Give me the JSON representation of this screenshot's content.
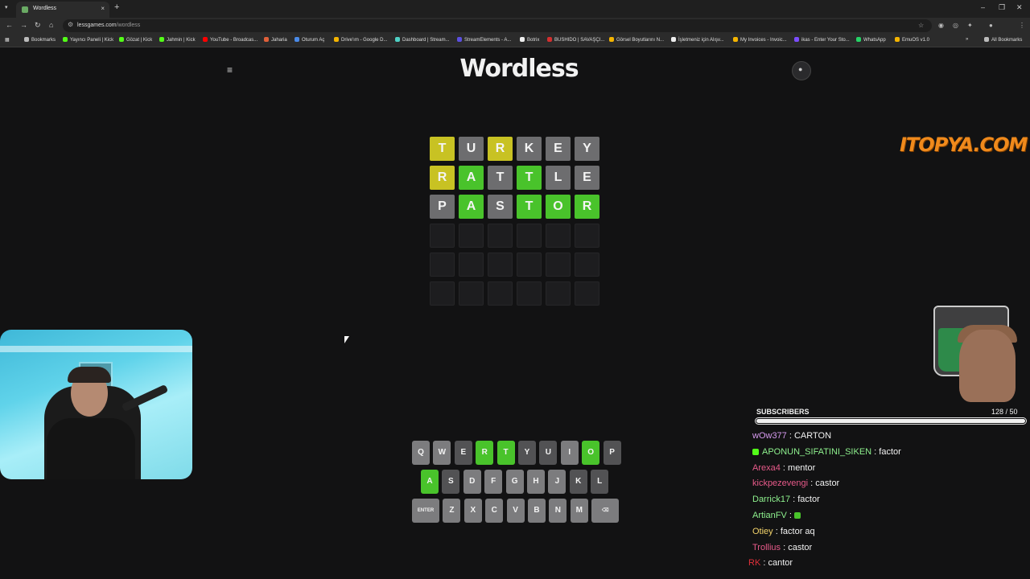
{
  "browser": {
    "tab_title": "Wordless",
    "url_host": "lessgames.com",
    "url_path": "/wordless",
    "bookmarks": [
      "Bookmarks",
      "Yayıncı Paneli | Kick",
      "Gözat | Kick",
      "Jahmin | Kick",
      "YouTube - Broadcas...",
      "Jaharia",
      "Oturum Aç",
      "Drive'ım - Google D...",
      "Dashboard | Stream...",
      "StreamElements - A...",
      "Botrix",
      "BUSHIDO | SAVAŞÇI...",
      "Görsel Boyutlarını N...",
      "İşletmeniz için Alışv...",
      "My Invoices - Invoic...",
      "ikas - Enter Your Sto...",
      "WhatsApp",
      "EmuOS v1.0"
    ],
    "all_bookmarks": "All Bookmarks",
    "icons": {
      "back": "←",
      "forward": "→",
      "reload": "↻",
      "home": "⌂",
      "star": "☆",
      "close": "×",
      "new_tab": "+",
      "menu": "⋮",
      "minimize": "–",
      "restore": "❐",
      "window_close": "✕",
      "apps": "▦",
      "tab_list": "▾",
      "tune": "⚙",
      "chevrons": "»"
    }
  },
  "app": {
    "title": "Wordless",
    "menu_icon": "≡",
    "profile_icon": "person-icon"
  },
  "board": [
    [
      {
        "l": "T",
        "s": "present"
      },
      {
        "l": "U",
        "s": "absent"
      },
      {
        "l": "R",
        "s": "present"
      },
      {
        "l": "K",
        "s": "absent"
      },
      {
        "l": "E",
        "s": "absent"
      },
      {
        "l": "Y",
        "s": "absent"
      }
    ],
    [
      {
        "l": "R",
        "s": "present"
      },
      {
        "l": "A",
        "s": "correct"
      },
      {
        "l": "T",
        "s": "absent"
      },
      {
        "l": "T",
        "s": "correct"
      },
      {
        "l": "L",
        "s": "absent"
      },
      {
        "l": "E",
        "s": "absent"
      }
    ],
    [
      {
        "l": "P",
        "s": "absent"
      },
      {
        "l": "A",
        "s": "correct"
      },
      {
        "l": "S",
        "s": "absent"
      },
      {
        "l": "T",
        "s": "correct"
      },
      {
        "l": "O",
        "s": "correct"
      },
      {
        "l": "R",
        "s": "correct"
      }
    ],
    [
      {
        "l": "",
        "s": "empty"
      },
      {
        "l": "",
        "s": "empty"
      },
      {
        "l": "",
        "s": "empty"
      },
      {
        "l": "",
        "s": "empty"
      },
      {
        "l": "",
        "s": "empty"
      },
      {
        "l": "",
        "s": "empty"
      }
    ],
    [
      {
        "l": "",
        "s": "empty"
      },
      {
        "l": "",
        "s": "empty"
      },
      {
        "l": "",
        "s": "empty"
      },
      {
        "l": "",
        "s": "empty"
      },
      {
        "l": "",
        "s": "empty"
      },
      {
        "l": "",
        "s": "empty"
      }
    ],
    [
      {
        "l": "",
        "s": "empty"
      },
      {
        "l": "",
        "s": "empty"
      },
      {
        "l": "",
        "s": "empty"
      },
      {
        "l": "",
        "s": "empty"
      },
      {
        "l": "",
        "s": "empty"
      },
      {
        "l": "",
        "s": "empty"
      }
    ]
  ],
  "keyboard": [
    [
      {
        "k": "Q",
        "s": ""
      },
      {
        "k": "W",
        "s": ""
      },
      {
        "k": "E",
        "s": "absent"
      },
      {
        "k": "R",
        "s": "correct"
      },
      {
        "k": "T",
        "s": "correct"
      },
      {
        "k": "Y",
        "s": "absent"
      },
      {
        "k": "U",
        "s": "absent"
      },
      {
        "k": "I",
        "s": ""
      },
      {
        "k": "O",
        "s": "correct"
      },
      {
        "k": "P",
        "s": "absent"
      }
    ],
    [
      {
        "k": "A",
        "s": "correct"
      },
      {
        "k": "S",
        "s": "absent"
      },
      {
        "k": "D",
        "s": ""
      },
      {
        "k": "F",
        "s": ""
      },
      {
        "k": "G",
        "s": ""
      },
      {
        "k": "H",
        "s": ""
      },
      {
        "k": "J",
        "s": ""
      },
      {
        "k": "K",
        "s": "absent"
      },
      {
        "k": "L",
        "s": "absent"
      }
    ],
    [
      {
        "k": "ENTER",
        "s": "wide"
      },
      {
        "k": "Z",
        "s": ""
      },
      {
        "k": "X",
        "s": ""
      },
      {
        "k": "C",
        "s": ""
      },
      {
        "k": "V",
        "s": ""
      },
      {
        "k": "B",
        "s": ""
      },
      {
        "k": "N",
        "s": ""
      },
      {
        "k": "M",
        "s": ""
      },
      {
        "k": "⌫",
        "s": "wide"
      }
    ]
  ],
  "overlay": {
    "sponsor": "ITOPYA.COM",
    "subscribers_label": "SUBSCRIBERS",
    "subscribers_count": "128 / 50",
    "subscribers_progress": 1.0,
    "chat": [
      {
        "user": "wOw377",
        "color": "#d79bf0",
        "msg": "CARTON",
        "badge": false
      },
      {
        "user": "APONUN_SIFATINI_SIKEN",
        "color": "#8ef18e",
        "msg": "factor",
        "badge": true
      },
      {
        "user": "Arexa4",
        "color": "#e85a8a",
        "msg": "mentor",
        "badge": false
      },
      {
        "user": "kickpezevengi",
        "color": "#e85a8a",
        "msg": "castor",
        "badge": false
      },
      {
        "user": "Darrick17",
        "color": "#8ef18e",
        "msg": "factor",
        "badge": false
      },
      {
        "user": "ArtianFV",
        "color": "#8ef18e",
        "msg": "",
        "badge": false,
        "emote": true
      },
      {
        "user": "Otiey",
        "color": "#f3d36b",
        "msg": "factor aq",
        "badge": false
      },
      {
        "user": "Trollius",
        "color": "#e85a8a",
        "msg": "castor",
        "badge": false
      },
      {
        "user": "RK",
        "color": "#e0303a",
        "msg": "cantor",
        "badge": false
      }
    ]
  }
}
